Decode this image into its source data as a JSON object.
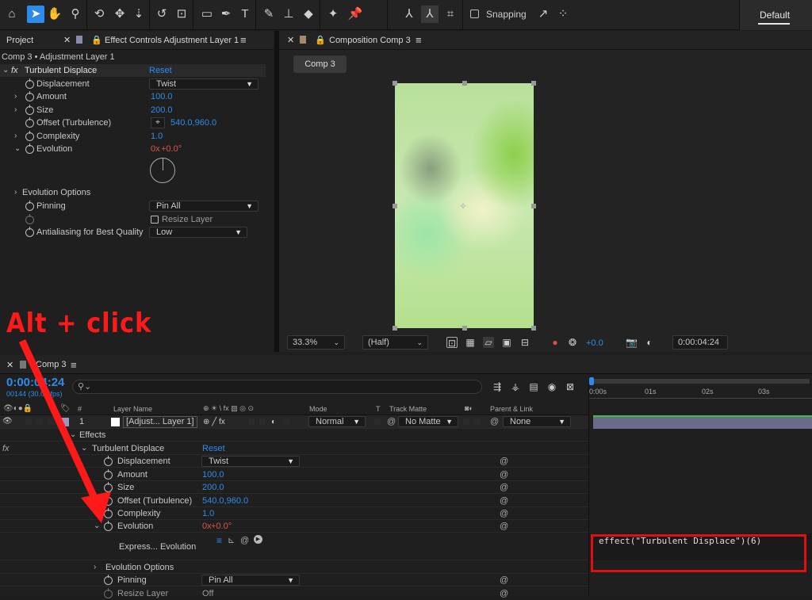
{
  "toolbar": {
    "icons": [
      "home-icon",
      "selection-tool-icon",
      "hand-tool-icon",
      "zoom-tool-icon",
      "orbit-tool-icon",
      "pan-tool-icon",
      "dolly-tool-icon",
      "rotate-tool-icon",
      "pan-behind-tool-icon",
      "rectangle-tool-icon",
      "pen-tool-icon",
      "type-tool-icon",
      "brush-tool-icon",
      "clone-stamp-icon",
      "eraser-icon",
      "roto-brush-icon",
      "puppet-pin-icon",
      "axis-local-icon",
      "axis-world-icon",
      "axis-view-icon",
      "snapping-options-icon",
      "snapping-grid-icon"
    ],
    "snapping_label": "Snapping",
    "workspace_label": "Default"
  },
  "project_tab": {
    "label": "Project"
  },
  "effect_controls": {
    "tab_label": "Effect Controls Adjustment Layer 1",
    "breadcrumb": "Comp 3 • Adjustment Layer 1",
    "fx_icon": "fx",
    "effect_name": "Turbulent Displace",
    "reset": "Reset",
    "displacement_label": "Displacement",
    "displacement_value": "Twist",
    "amount_label": "Amount",
    "amount_value": "100.0",
    "size_label": "Size",
    "size_value": "200.0",
    "offset_label": "Offset (Turbulence)",
    "offset_value": "540.0,960.0",
    "complexity_label": "Complexity",
    "complexity_value": "1.0",
    "evolution_label": "Evolution",
    "evolution_rev": "0x",
    "evolution_deg": "+0.0°",
    "evolution_options_label": "Evolution Options",
    "pinning_label": "Pinning",
    "pinning_value": "Pin All",
    "resize_layer_label": "Resize Layer",
    "antialiasing_label": "Antialiasing for Best Quality",
    "antialiasing_value": "Low"
  },
  "composition": {
    "tab_label": "Composition Comp 3",
    "comp_button": "Comp 3",
    "zoom": "33.3%",
    "resolution": "(Half)",
    "exposure": "+0.0",
    "timecode": "0:00:04:24"
  },
  "annotation": {
    "text": "Alt + click",
    "color": "#ff1a1a"
  },
  "timeline": {
    "tab_label": "Comp 3",
    "timecode": "0:00:04:24",
    "frame_info": "00144 (30.00 fps)",
    "search_placeholder": "",
    "headers": {
      "num": "#",
      "layer_name": "Layer Name",
      "switches": "⊕ ☀ \\ fx ▨ ◎ ⊙",
      "mode": "Mode",
      "t": "T",
      "track_matte": "Track Matte",
      "parent": "Parent & Link"
    },
    "ruler": [
      "0:00s",
      "01s",
      "02s",
      "03s"
    ],
    "layer": {
      "index": "1",
      "name": "[Adjust... Layer 1]",
      "mode": "Normal",
      "matte": "No Matte",
      "parent": "None"
    },
    "rows": {
      "effects": "Effects",
      "fx": "fx",
      "effect_name": "Turbulent Displace",
      "reset": "Reset",
      "displacement_label": "Displacement",
      "displacement_value": "Twist",
      "amount_label": "Amount",
      "amount_value": "100.0",
      "size_label": "Size",
      "size_value": "200.0",
      "offset_label": "Offset (Turbulence)",
      "offset_value": "540.0,960.0",
      "complexity_label": "Complexity",
      "complexity_value": "1.0",
      "evolution_label": "Evolution",
      "evolution_rev": "0x",
      "evolution_deg": "+0.0°",
      "expression_label": "Express... Evolution",
      "evolution_options_label": "Evolution Options",
      "pinning_label": "Pinning",
      "pinning_value": "Pin All",
      "resize_label": "Resize Layer",
      "resize_value": "Off"
    },
    "expression_code": "effect(\"Turbulent Displace\")(6)"
  },
  "colors": {
    "accent": "#2d8ceb",
    "annotation_red": "#ff1a1a",
    "value_red": "#e0534a",
    "timeline_green": "#4ab84a"
  }
}
